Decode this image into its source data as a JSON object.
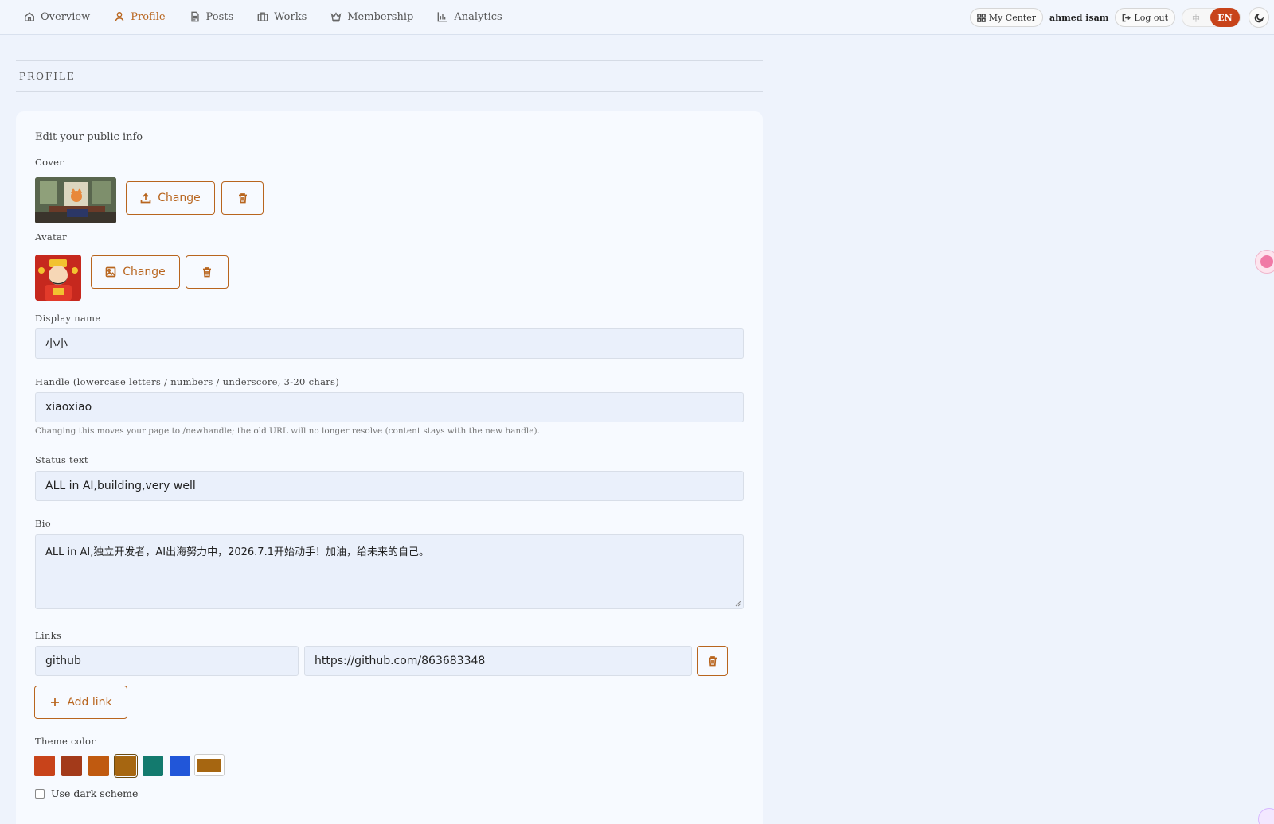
{
  "nav": {
    "items": [
      {
        "label": "Overview",
        "icon": "home-icon"
      },
      {
        "label": "Profile",
        "icon": "user-icon",
        "active": true
      },
      {
        "label": "Posts",
        "icon": "document-icon"
      },
      {
        "label": "Works",
        "icon": "briefcase-icon"
      },
      {
        "label": "Membership",
        "icon": "crown-icon"
      },
      {
        "label": "Analytics",
        "icon": "bar-chart-icon"
      }
    ]
  },
  "header_right": {
    "my_center": "My Center",
    "username": "ahmed isam",
    "logout": "Log out",
    "lang_zh": "中",
    "lang_en": "EN"
  },
  "section": {
    "title": "PROFILE"
  },
  "card": {
    "title": "Edit your public info",
    "cover": {
      "label": "Cover",
      "change": "Change"
    },
    "avatar": {
      "label": "Avatar",
      "change": "Change"
    },
    "display_name": {
      "label": "Display name",
      "value": "小小"
    },
    "handle": {
      "label": "Handle (lowercase letters / numbers / underscore, 3-20 chars)",
      "value": "xiaoxiao",
      "hint": "Changing this moves your page to /newhandle; the old URL will no longer resolve (content stays with the new handle)."
    },
    "status": {
      "label": "Status text",
      "value": "ALL in AI,building,very well"
    },
    "bio": {
      "label": "Bio",
      "value": "ALL in AI,独立开发者，AI出海努力中，2026.7.1开始动手！加油，给未来的自己。"
    },
    "links": {
      "label": "Links",
      "rows": [
        {
          "name": "github",
          "url": "https://github.com/863683348"
        }
      ],
      "add": "Add link"
    },
    "theme": {
      "label": "Theme color",
      "swatches": [
        "#c8431a",
        "#a33a1a",
        "#c05a10",
        "#a66611",
        "#137a6e",
        "#2156d9"
      ],
      "selected_index": 3,
      "custom": "#a66611"
    },
    "dark_scheme": {
      "label": "Use dark scheme",
      "checked": false
    }
  },
  "colors": {
    "accent": "#b8651e",
    "brand_red": "#c8431a"
  }
}
